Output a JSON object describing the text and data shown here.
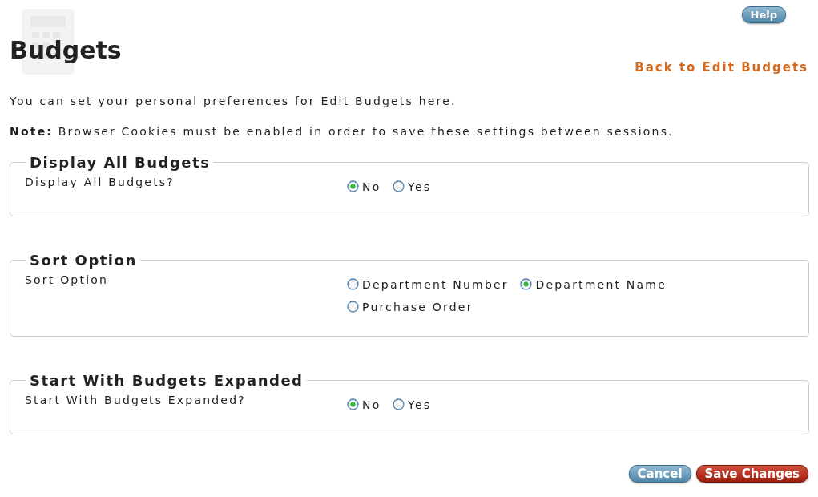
{
  "header": {
    "title": "Budgets",
    "help_button": "Help",
    "back_link": "Back to Edit Budgets"
  },
  "intro": "You can set your personal preferences for Edit Budgets here.",
  "note": "**Note:** Browser Cookies must be enabled in order to save these settings between sessions.",
  "sections": [
    {
      "legend": "Display All Budgets",
      "label": "Display All Budgets?",
      "options": [
        {
          "label": "No",
          "selected": true
        },
        {
          "label": "Yes",
          "selected": false
        }
      ]
    },
    {
      "legend": "Sort Option",
      "label": "Sort Option",
      "options": [
        {
          "label": "Department Number",
          "selected": false
        },
        {
          "label": "Department Name",
          "selected": true
        },
        {
          "label": "Purchase Order",
          "selected": false
        }
      ]
    },
    {
      "legend": "Start With Budgets Expanded",
      "label": "Start With Budgets Expanded?",
      "options": [
        {
          "label": "No",
          "selected": true
        },
        {
          "label": "Yes",
          "selected": false
        }
      ]
    }
  ],
  "buttons": {
    "cancel": "Cancel",
    "save": "Save Changes"
  }
}
